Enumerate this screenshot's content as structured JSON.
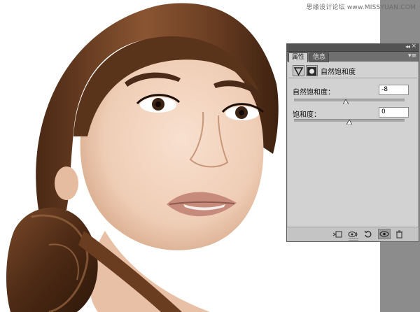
{
  "watermark": "思缘设计论坛 www.MISSYUAN.COM",
  "panel": {
    "tabs": [
      {
        "label": "属性",
        "active": true
      },
      {
        "label": "信息",
        "active": false
      }
    ],
    "adjustment_title": "自然饱和度",
    "params": [
      {
        "label": "自然饱和度：",
        "value": "-8",
        "slider_fraction": 0.47
      },
      {
        "label": "饱和度：",
        "value": "0",
        "slider_fraction": 0.5
      }
    ],
    "bottom_icons": [
      "clip-to-layer-icon",
      "view-previous-icon",
      "reset-icon",
      "visibility-icon",
      "delete-icon"
    ]
  },
  "colors": {
    "panel_bg": "#d2d2d2",
    "panel_header": "#535353",
    "pasteboard": "#8c8c8c",
    "hair": "#6b3f22",
    "skin": "#f2d2bd"
  }
}
